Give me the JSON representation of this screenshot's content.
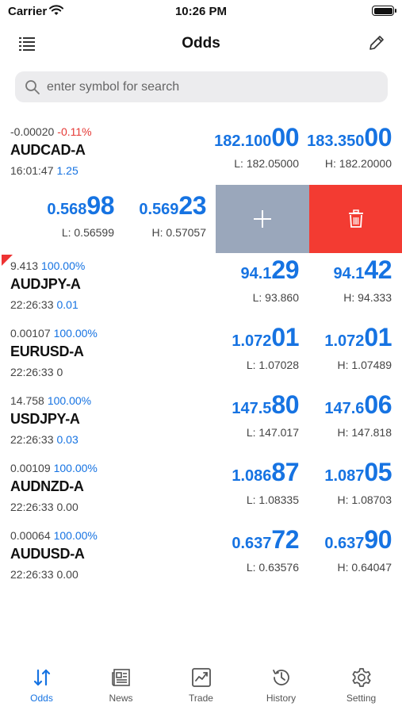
{
  "status": {
    "carrier": "Carrier",
    "time": "10:26 PM"
  },
  "nav": {
    "title": "Odds"
  },
  "search": {
    "placeholder": "enter symbol for search"
  },
  "rows": [
    {
      "change": "-0.00020",
      "change_pct": "-0.11%",
      "change_pct_color": "#e53935",
      "symbol": "AUDCAD-A",
      "time": "16:01:47",
      "spread": "1.25",
      "spread_color": "#1673e2",
      "bid_small": "182.100",
      "bid_big": "00",
      "ask_small": "183.350",
      "ask_big": "00",
      "low": "L: 182.05000",
      "high": "H: 182.20000"
    },
    {
      "change": "9.413",
      "change_pct": "100.00%",
      "change_pct_color": "#1673e2",
      "symbol": "AUDJPY-A",
      "time": "22:26:33",
      "spread": "0.01",
      "spread_color": "#1673e2",
      "bid_small": "94.1",
      "bid_big": "29",
      "ask_small": "94.1",
      "ask_big": "42",
      "low": "L: 93.860",
      "high": "H: 94.333"
    },
    {
      "change": "0.00107",
      "change_pct": "100.00%",
      "change_pct_color": "#1673e2",
      "symbol": "EURUSD-A",
      "time": "22:26:33",
      "spread": "0",
      "spread_color": "#444444",
      "bid_small": "1.072",
      "bid_big": "01",
      "ask_small": "1.072",
      "ask_big": "01",
      "low": "L: 1.07028",
      "high": "H: 1.07489"
    },
    {
      "change": "14.758",
      "change_pct": "100.00%",
      "change_pct_color": "#1673e2",
      "symbol": "USDJPY-A",
      "time": "22:26:33",
      "spread": "0.03",
      "spread_color": "#1673e2",
      "bid_small": "147.5",
      "bid_big": "80",
      "ask_small": "147.6",
      "ask_big": "06",
      "low": "L: 147.017",
      "high": "H: 147.818"
    },
    {
      "change": "0.00109",
      "change_pct": "100.00%",
      "change_pct_color": "#1673e2",
      "symbol": "AUDNZD-A",
      "time": "22:26:33",
      "spread": "0.00",
      "spread_color": "#444444",
      "bid_small": "1.086",
      "bid_big": "87",
      "ask_small": "1.087",
      "ask_big": "05",
      "low": "L: 1.08335",
      "high": "H: 1.08703"
    },
    {
      "change": "0.00064",
      "change_pct": "100.00%",
      "change_pct_color": "#1673e2",
      "symbol": "AUDUSD-A",
      "time": "22:26:33",
      "spread": "0.00",
      "spread_color": "#444444",
      "bid_small": "0.637",
      "bid_big": "72",
      "ask_small": "0.637",
      "ask_big": "90",
      "low": "L: 0.63576",
      "high": "H: 0.64047"
    }
  ],
  "swiped_row": {
    "bid_small": "0.568",
    "bid_big": "98",
    "ask_small": "0.569",
    "ask_big": "23",
    "low": "L: 0.56599",
    "high": "H: 0.57057",
    "add_icon": "plus-icon",
    "delete_icon": "trash-icon"
  },
  "tabs": [
    {
      "label": "Odds",
      "icon": "odds-arrows-icon",
      "active": true
    },
    {
      "label": "News",
      "icon": "newspaper-icon",
      "active": false
    },
    {
      "label": "Trade",
      "icon": "chart-icon",
      "active": false
    },
    {
      "label": "History",
      "icon": "history-clock-icon",
      "active": false
    },
    {
      "label": "Setting",
      "icon": "gear-icon",
      "active": false
    }
  ],
  "colors": {
    "accent": "#1673e2",
    "negative": "#e53935",
    "add_action": "#9aa7bb",
    "delete_action": "#f33b32"
  }
}
